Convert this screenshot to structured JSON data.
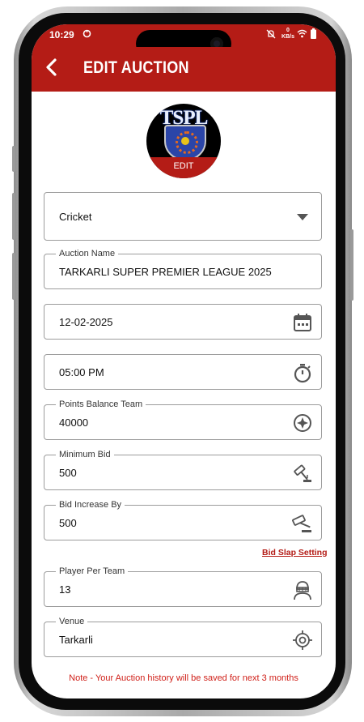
{
  "status_bar": {
    "time": "10:29",
    "data_speed_value": "0",
    "data_speed_unit": "KB/s"
  },
  "app_bar": {
    "title": "EDIT AUCTION",
    "back_icon": "back-arrow-icon",
    "color": "#b41c16"
  },
  "logo": {
    "text": "TSPL",
    "edit_label": "EDIT"
  },
  "form": {
    "sport": {
      "value": "Cricket",
      "icon": "dropdown-caret-icon"
    },
    "auction_name": {
      "label": "Auction Name",
      "value": "TARKARLI SUPER PREMIER LEAGUE 2025"
    },
    "date": {
      "value": "12-02-2025",
      "icon": "calendar-icon"
    },
    "time": {
      "value": "05:00 PM",
      "icon": "stopwatch-icon"
    },
    "points_balance": {
      "label": "Points Balance Team",
      "value": "40000",
      "icon": "compass-icon"
    },
    "minimum_bid": {
      "label": "Minimum Bid",
      "value": "500",
      "icon": "gavel-icon"
    },
    "bid_increase": {
      "label": "Bid Increase By",
      "value": "500",
      "icon": "gavel-icon"
    },
    "bid_slap_link": "Bid Slap Setting",
    "player_per_team": {
      "label": "Player Per Team",
      "value": "13",
      "icon": "player-helmet-icon"
    },
    "venue": {
      "label": "Venue",
      "value": "Tarkarli",
      "icon": "location-target-icon"
    }
  },
  "note": "Note - Your Auction history will be saved for next 3 months"
}
